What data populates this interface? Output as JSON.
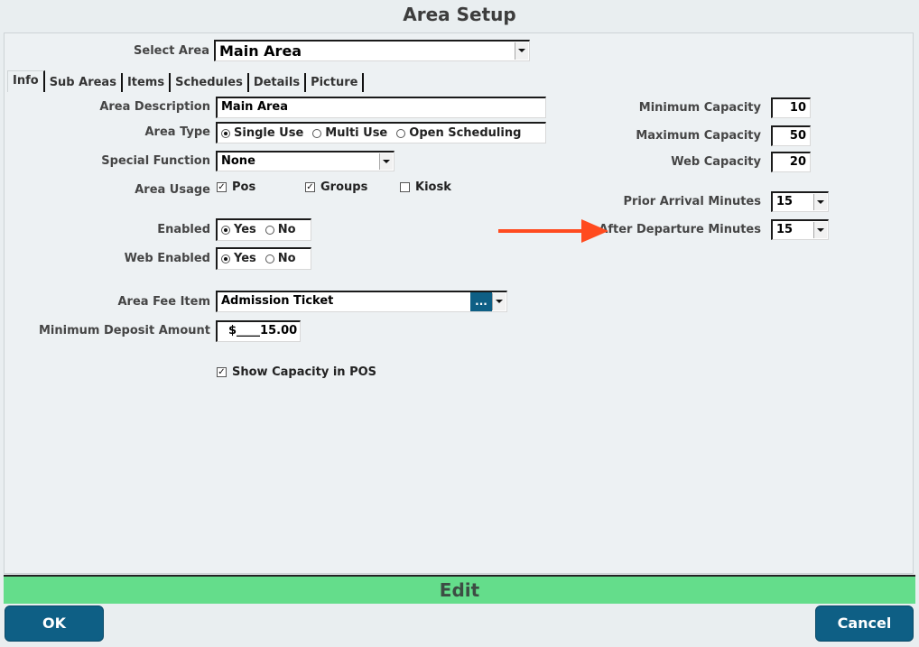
{
  "title": "Area Setup",
  "select_area": {
    "label": "Select Area",
    "value": "Main Area"
  },
  "tabs": [
    "Info",
    "Sub Areas",
    "Items",
    "Schedules",
    "Details",
    "Picture"
  ],
  "form": {
    "area_description": {
      "label": "Area Description",
      "value": "Main Area"
    },
    "area_type": {
      "label": "Area Type",
      "options": [
        "Single Use",
        "Multi Use",
        "Open Scheduling"
      ],
      "selected": "Single Use"
    },
    "special_function": {
      "label": "Special Function",
      "value": "None"
    },
    "area_usage": {
      "label": "Area Usage",
      "options": [
        {
          "label": "Pos",
          "checked": true
        },
        {
          "label": "Groups",
          "checked": true
        },
        {
          "label": "Kiosk",
          "checked": false
        }
      ]
    },
    "enabled": {
      "label": "Enabled",
      "yes": "Yes",
      "no": "No",
      "selected": "Yes"
    },
    "web_enabled": {
      "label": "Web Enabled",
      "yes": "Yes",
      "no": "No",
      "selected": "Yes"
    },
    "area_fee_item": {
      "label": "Area Fee Item",
      "value": "Admission Ticket",
      "browse": "..."
    },
    "minimum_deposit": {
      "label": "Minimum Deposit Amount",
      "value": "$____15.00"
    },
    "show_capacity": {
      "label": "Show Capacity in POS",
      "checked": true
    }
  },
  "capacity": {
    "minimum": {
      "label": "Minimum Capacity",
      "value": "10"
    },
    "maximum": {
      "label": "Maximum Capacity",
      "value": "50"
    },
    "web": {
      "label": "Web Capacity",
      "value": "20"
    },
    "prior_arrival": {
      "label": "Prior Arrival Minutes",
      "value": "15"
    },
    "after_departure": {
      "label": "After Departure Minutes",
      "value": "15"
    }
  },
  "status_bar": "Edit",
  "buttons": {
    "ok": "OK",
    "cancel": "Cancel"
  },
  "colors": {
    "accent": "#0e5f85",
    "status_bar": "#64dd8b",
    "annotation_arrow": "#ff4b1f"
  }
}
